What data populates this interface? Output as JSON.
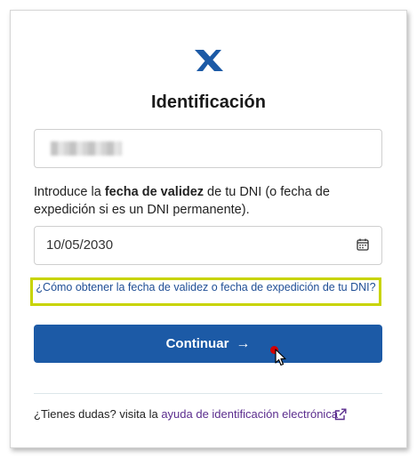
{
  "title": "Identificación",
  "instruction": {
    "prefix": "Introduce la ",
    "bold": "fecha de validez",
    "suffix": " de tu DNI (o fecha de expedición si es un DNI permanente)."
  },
  "date_input": {
    "value": "10/05/2030"
  },
  "help_link": "¿Cómo obtener la fecha de validez o fecha de expedición de tu DNI?",
  "button": {
    "label": "Continuar",
    "arrow": "→"
  },
  "footer": {
    "text": "¿Tienes dudas? visita la ",
    "link": "ayuda de identificación electrónica"
  },
  "colors": {
    "primary": "#1c5aa6",
    "highlight_border": "#c8d400",
    "link": "#1f4e95",
    "footer_link": "#5b2d8e"
  }
}
